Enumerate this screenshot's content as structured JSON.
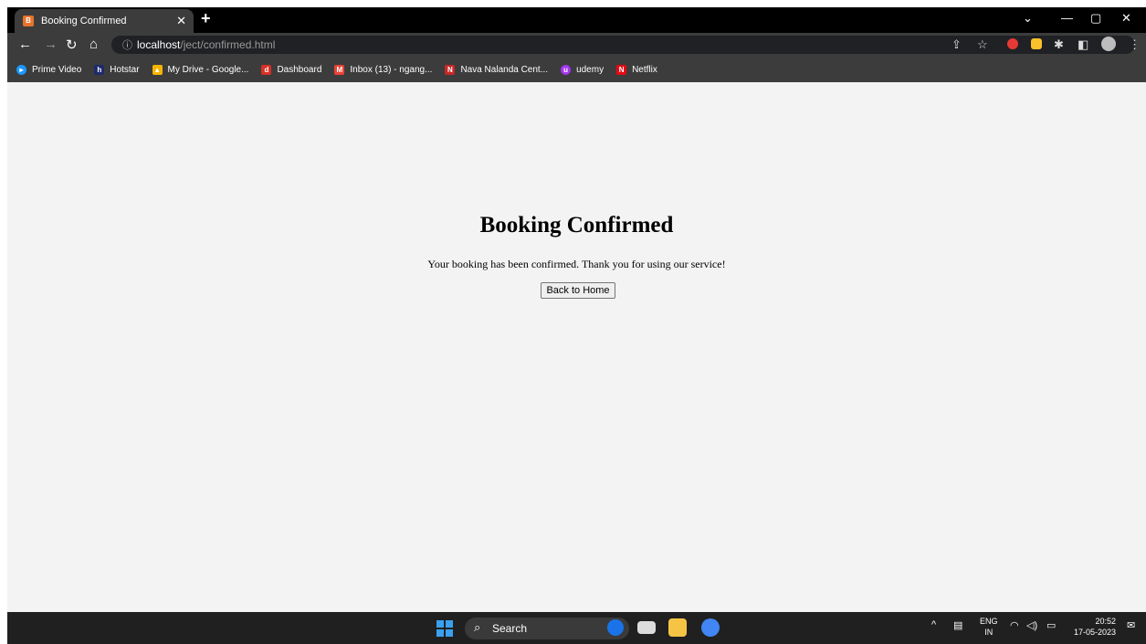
{
  "browser": {
    "tab_title": "Booking Confirmed",
    "url_host": "localhost",
    "url_path": "/ject/confirmed.html"
  },
  "bookmarks": [
    {
      "label": "Prime Video",
      "color": "#1a98ff"
    },
    {
      "label": "Hotstar",
      "color": "#1f2b6b"
    },
    {
      "label": "My Drive - Google...",
      "color": "#f4b400"
    },
    {
      "label": "Dashboard",
      "color": "#d93025"
    },
    {
      "label": "Inbox (13) - ngang...",
      "color": "#ea4335"
    },
    {
      "label": "Nava Nalanda Cent...",
      "color": "#c62828"
    },
    {
      "label": "udemy",
      "color": "#a435f0"
    },
    {
      "label": "Netflix",
      "color": "#e50914"
    }
  ],
  "page": {
    "heading": "Booking Confirmed",
    "message": "Your booking has been confirmed. Thank you for using our service!",
    "button_label": "Back to Home"
  },
  "taskbar": {
    "search_label": "Search",
    "lang_primary": "ENG",
    "lang_secondary": "IN",
    "time": "20:52",
    "date": "17-05-2023"
  }
}
